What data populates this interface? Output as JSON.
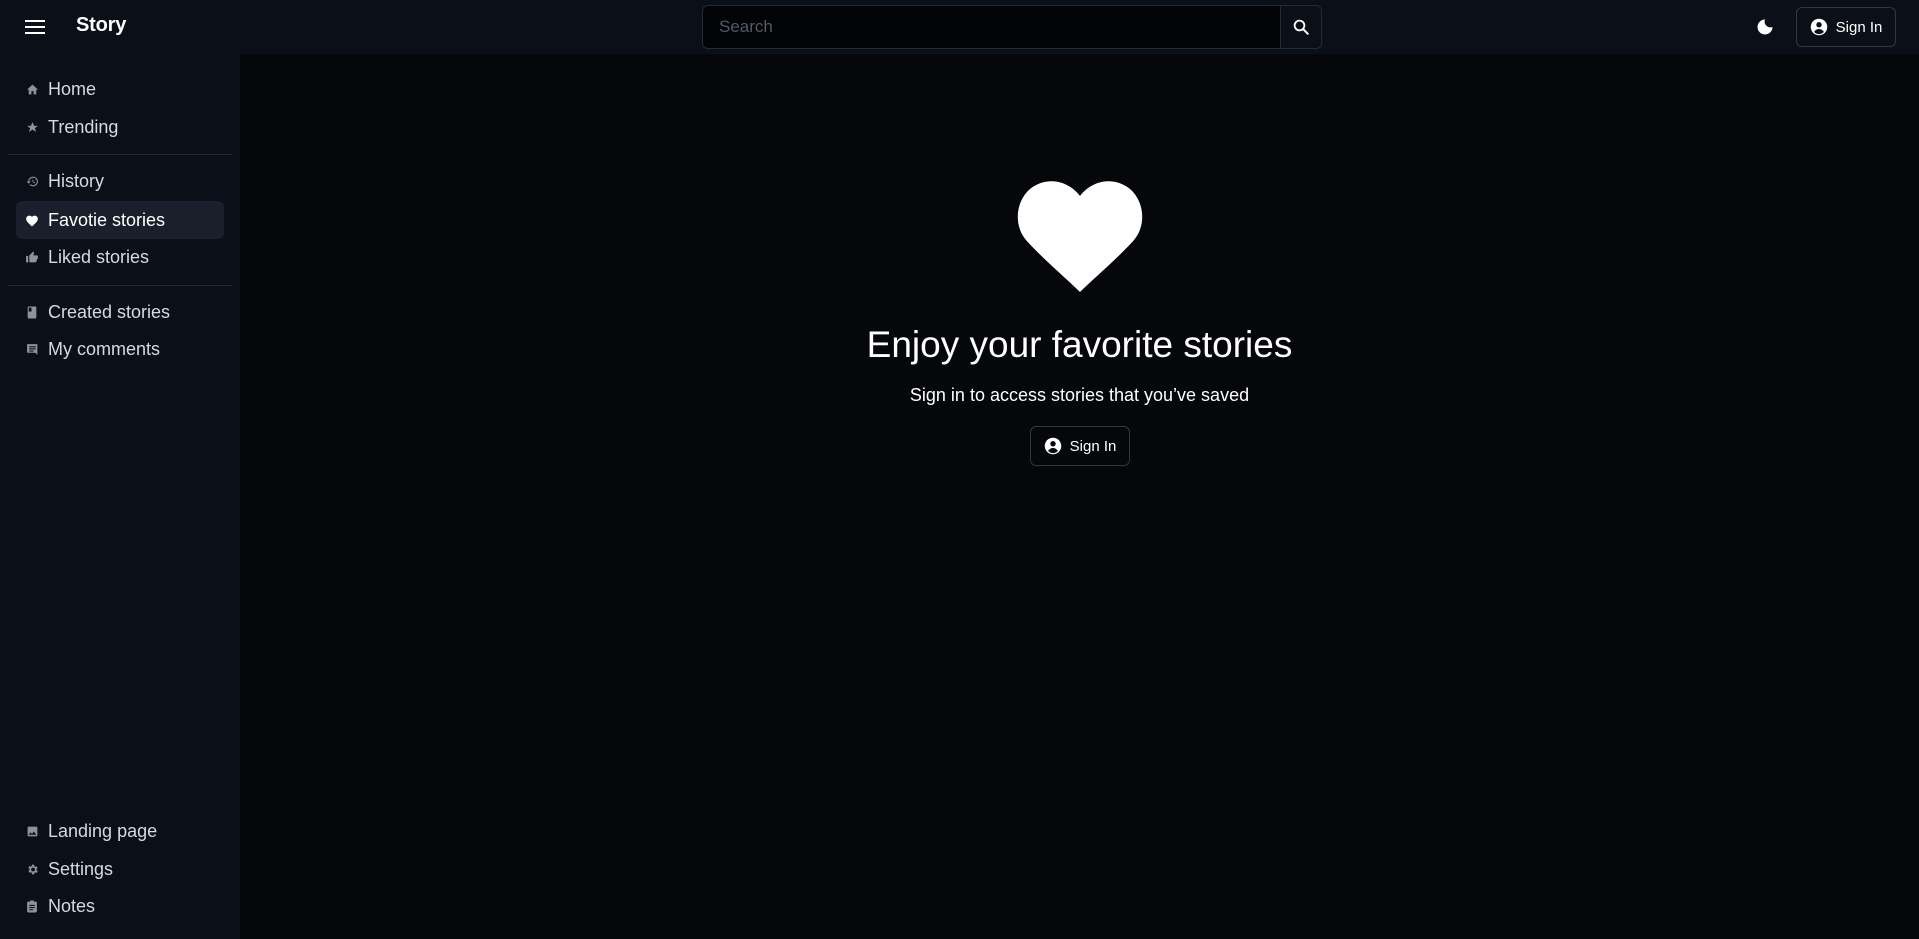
{
  "header": {
    "brand": "Story",
    "menu_icon": "menu-icon",
    "search_placeholder": "Search",
    "search_value": "",
    "search_icon": "search-icon",
    "theme_icon": "moon-icon",
    "signin_label": "Sign In",
    "signin_icon": "account-circle-icon"
  },
  "sidebar": {
    "groups": [
      [
        {
          "label": "Home",
          "icon": "home-icon"
        },
        {
          "label": "Trending",
          "icon": "star-icon"
        }
      ],
      [
        {
          "label": "History",
          "icon": "history-icon"
        },
        {
          "label": "Favotie stories",
          "icon": "heart-icon",
          "active": true
        },
        {
          "label": "Liked stories",
          "icon": "thumb-up-icon"
        }
      ],
      [
        {
          "label": "Created stories",
          "icon": "book-icon"
        },
        {
          "label": "My comments",
          "icon": "comment-icon"
        }
      ]
    ],
    "bottom": [
      {
        "label": "Landing page",
        "icon": "image-icon"
      },
      {
        "label": "Settings",
        "icon": "gear-icon"
      },
      {
        "label": "Notes",
        "icon": "clipboard-icon"
      }
    ]
  },
  "main": {
    "empty_icon": "heart-icon",
    "title": "Enjoy your favorite stories",
    "subtitle": "Sign in to access stories that you’ve saved",
    "signin_label": "Sign In",
    "signin_icon": "account-circle-icon"
  },
  "colors": {
    "background": "#05070b",
    "surface": "#0b0f17",
    "active_item": "#1a202b",
    "border": "#2f3744",
    "text": "#ffffff",
    "icon_muted": "#8b93a0"
  }
}
